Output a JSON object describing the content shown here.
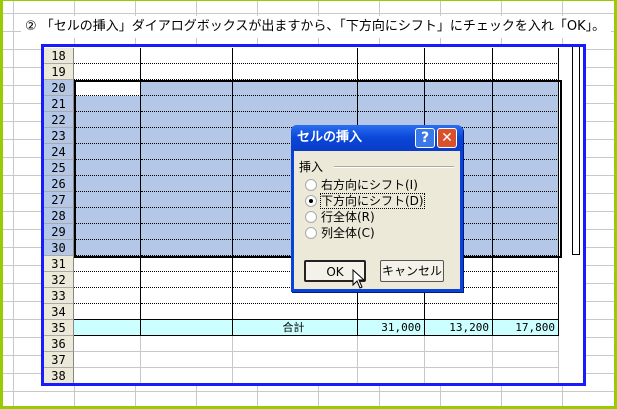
{
  "instruction": "② 「セルの挿入」ダイアログボックスが出ますから、「下方向にシフト」にチェックを入れ「OK」。",
  "sheet": {
    "rows": [
      18,
      19,
      20,
      21,
      22,
      23,
      24,
      25,
      26,
      27,
      28,
      29,
      30,
      31,
      32,
      33,
      34,
      35,
      36,
      37,
      38
    ],
    "selected_rows": [
      20,
      30
    ],
    "total_row": {
      "row": 35,
      "label": "合計",
      "values": [
        "31,000",
        "13,200",
        "17,800"
      ]
    }
  },
  "dialog": {
    "title": "セルの挿入",
    "help_icon": "question-icon",
    "close_icon": "close-icon",
    "group_label": "挿入",
    "options": [
      {
        "label": "右方向にシフト(I)",
        "selected": false
      },
      {
        "label": "下方向にシフト(D)",
        "selected": true
      },
      {
        "label": "行全体(R)",
        "selected": false
      },
      {
        "label": "列全体(C)",
        "selected": false
      }
    ],
    "ok": "OK",
    "cancel": "キャンセル"
  },
  "colors": {
    "frame": "#1a1aff",
    "selection": "#b4c7e7",
    "total_row": "#ccffff",
    "titlebar": "#0a46d8",
    "page_border": "#99cc00"
  }
}
